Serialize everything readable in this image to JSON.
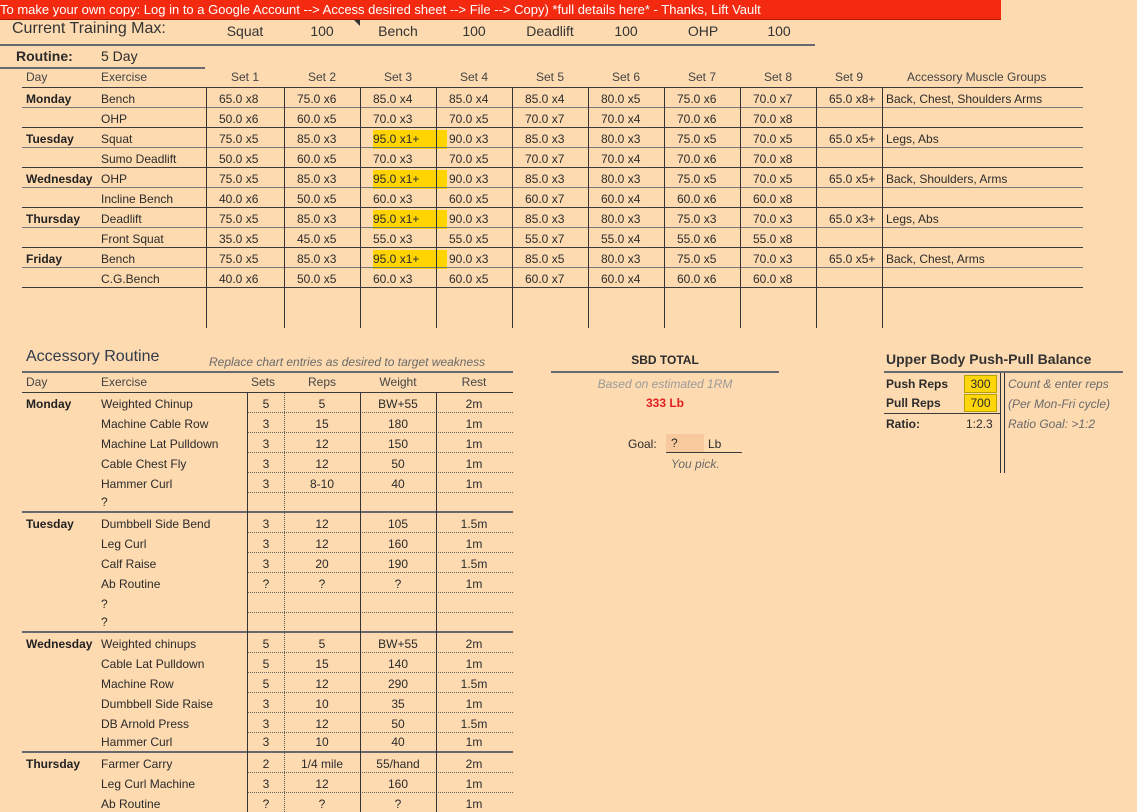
{
  "banner": "To make your own copy: Log in to a Google Account --> Access desired sheet --> File --> Copy) *full details here* - Thanks, Lift Vault",
  "tm": {
    "label": "Current Training Max:",
    "items": [
      {
        "name": "Squat",
        "value": "100"
      },
      {
        "name": "Bench",
        "value": "100"
      },
      {
        "name": "Deadlift",
        "value": "100"
      },
      {
        "name": "OHP",
        "value": "100"
      }
    ]
  },
  "routine": {
    "label": "Routine:",
    "value": "5 Day"
  },
  "main_headers": [
    "Day",
    "Exercise",
    "Set 1",
    "Set 2",
    "Set 3",
    "Set 4",
    "Set 5",
    "Set 6",
    "Set 7",
    "Set 8",
    "Set 9",
    "Accessory Muscle Groups"
  ],
  "main_rows": [
    {
      "day": "Monday",
      "ex": "Bench",
      "sets": [
        "65.0 x8",
        "75.0 x6",
        "85.0 x4",
        "85.0 x4",
        "85.0 x4",
        "80.0 x5",
        "75.0 x6",
        "70.0 x7",
        "65.0 x8+"
      ],
      "acc": "Back, Chest, Shoulders Arms"
    },
    {
      "day": "",
      "ex": "OHP",
      "sets": [
        "50.0 x6",
        "60.0 x5",
        "70.0 x3",
        "70.0 x5",
        "70.0 x7",
        "70.0 x4",
        "70.0 x6",
        "70.0 x8",
        ""
      ],
      "acc": ""
    },
    {
      "day": "Tuesday",
      "ex": "Squat",
      "sets": [
        "75.0 x5",
        "85.0 x3",
        "95.0 x1+",
        "90.0 x3",
        "85.0 x3",
        "80.0 x3",
        "75.0 x5",
        "70.0 x5",
        "65.0 x5+"
      ],
      "acc": "Legs, Abs"
    },
    {
      "day": "",
      "ex": "Sumo Deadlift",
      "sets": [
        "50.0 x5",
        "60.0 x5",
        "70.0 x3",
        "70.0 x5",
        "70.0 x7",
        "70.0 x4",
        "70.0 x6",
        "70.0 x8",
        ""
      ],
      "acc": ""
    },
    {
      "day": "Wednesday",
      "ex": "OHP",
      "sets": [
        "75.0 x5",
        "85.0 x3",
        "95.0 x1+",
        "90.0 x3",
        "85.0 x3",
        "80.0 x3",
        "75.0 x5",
        "70.0 x5",
        "65.0 x5+"
      ],
      "acc": "Back, Shoulders, Arms"
    },
    {
      "day": "",
      "ex": "Incline Bench",
      "sets": [
        "40.0 x6",
        "50.0 x5",
        "60.0 x3",
        "60.0 x5",
        "60.0 x7",
        "60.0 x4",
        "60.0 x6",
        "60.0 x8",
        ""
      ],
      "acc": ""
    },
    {
      "day": "Thursday",
      "ex": "Deadlift",
      "sets": [
        "75.0 x5",
        "85.0 x3",
        "95.0 x1+",
        "90.0 x3",
        "85.0 x3",
        "80.0 x3",
        "75.0 x3",
        "70.0 x3",
        "65.0 x3+"
      ],
      "acc": "Legs, Abs"
    },
    {
      "day": "",
      "ex": "Front Squat",
      "sets": [
        "35.0 x5",
        "45.0 x5",
        "55.0 x3",
        "55.0 x5",
        "55.0 x7",
        "55.0 x4",
        "55.0 x6",
        "55.0 x8",
        ""
      ],
      "acc": ""
    },
    {
      "day": "Friday",
      "ex": "Bench",
      "sets": [
        "75.0 x5",
        "85.0 x3",
        "95.0 x1+",
        "90.0 x3",
        "85.0 x5",
        "80.0 x3",
        "75.0 x5",
        "70.0 x3",
        "65.0 x5+"
      ],
      "acc": "Back, Chest, Arms"
    },
    {
      "day": "",
      "ex": "C.G.Bench",
      "sets": [
        "40.0 x6",
        "50.0 x5",
        "60.0 x3",
        "60.0 x5",
        "60.0 x7",
        "60.0 x4",
        "60.0 x6",
        "60.0 x8",
        ""
      ],
      "acc": ""
    }
  ],
  "accessory": {
    "title": "Accessory Routine",
    "hint": "Replace chart entries as desired to target weakness",
    "headers": [
      "Day",
      "Exercise",
      "Sets",
      "Reps",
      "Weight",
      "Rest"
    ],
    "rows": [
      {
        "day": "Monday",
        "ex": "Weighted Chinup",
        "sets": "5",
        "reps": "5",
        "weight": "BW+55",
        "rest": "2m"
      },
      {
        "day": "",
        "ex": "Machine Cable Row",
        "sets": "3",
        "reps": "15",
        "weight": "180",
        "rest": "1m"
      },
      {
        "day": "",
        "ex": "Machine Lat Pulldown",
        "sets": "3",
        "reps": "12",
        "weight": "150",
        "rest": "1m"
      },
      {
        "day": "",
        "ex": "Cable Chest Fly",
        "sets": "3",
        "reps": "12",
        "weight": "50",
        "rest": "1m"
      },
      {
        "day": "",
        "ex": "Hammer Curl",
        "sets": "3",
        "reps": "8-10",
        "weight": "40",
        "rest": "1m"
      },
      {
        "day": "",
        "ex": "?",
        "sets": "",
        "reps": "",
        "weight": "",
        "rest": ""
      },
      {
        "day": "Tuesday",
        "ex": "Dumbbell Side Bend",
        "sets": "3",
        "reps": "12",
        "weight": "105",
        "rest": "1.5m"
      },
      {
        "day": "",
        "ex": "Leg Curl",
        "sets": "3",
        "reps": "12",
        "weight": "160",
        "rest": "1m"
      },
      {
        "day": "",
        "ex": "Calf Raise",
        "sets": "3",
        "reps": "20",
        "weight": "190",
        "rest": "1.5m"
      },
      {
        "day": "",
        "ex": "Ab Routine",
        "sets": "?",
        "reps": "?",
        "weight": "?",
        "rest": "1m"
      },
      {
        "day": "",
        "ex": "?",
        "sets": "",
        "reps": "",
        "weight": "",
        "rest": ""
      },
      {
        "day": "",
        "ex": "?",
        "sets": "",
        "reps": "",
        "weight": "",
        "rest": ""
      },
      {
        "day": "Wednesday",
        "ex": "Weighted chinups",
        "sets": "5",
        "reps": "5",
        "weight": "BW+55",
        "rest": "2m"
      },
      {
        "day": "",
        "ex": "Cable Lat Pulldown",
        "sets": "5",
        "reps": "15",
        "weight": "140",
        "rest": "1m"
      },
      {
        "day": "",
        "ex": "Machine Row",
        "sets": "5",
        "reps": "12",
        "weight": "290",
        "rest": "1.5m"
      },
      {
        "day": "",
        "ex": "Dumbbell Side Raise",
        "sets": "3",
        "reps": "10",
        "weight": "35",
        "rest": "1m"
      },
      {
        "day": "",
        "ex": "DB Arnold Press",
        "sets": "3",
        "reps": "12",
        "weight": "50",
        "rest": "1.5m"
      },
      {
        "day": "",
        "ex": "Hammer Curl",
        "sets": "3",
        "reps": "10",
        "weight": "40",
        "rest": "1m"
      },
      {
        "day": "Thursday",
        "ex": "Farmer Carry",
        "sets": "2",
        "reps": "1/4 mile",
        "weight": "55/hand",
        "rest": "2m"
      },
      {
        "day": "",
        "ex": "Leg Curl Machine",
        "sets": "3",
        "reps": "12",
        "weight": "160",
        "rest": "1m"
      },
      {
        "day": "",
        "ex": "Ab Routine",
        "sets": "?",
        "reps": "?",
        "weight": "?",
        "rest": "1m"
      }
    ]
  },
  "sbd": {
    "title": "SBD TOTAL",
    "note": "Based on estimated 1RM",
    "total": "333 Lb",
    "goal_label": "Goal:",
    "goal_value": "?",
    "goal_unit": "Lb",
    "goal_note": "You pick."
  },
  "balance": {
    "title": "Upper Body Push-Pull Balance",
    "push_label": "Push Reps",
    "push_value": "300",
    "pull_label": "Pull Reps",
    "pull_value": "700",
    "ratio_label": "Ratio:",
    "ratio_value": "1:2.3",
    "note1": "Count & enter reps",
    "note2": "(Per Mon-Fri cycle)",
    "note3": "Ratio Goal: >1:2"
  },
  "colors": {
    "highlight": "#ffd400",
    "total_red": "#e02020",
    "banner": "#f42a10",
    "sheet_bg": "#fddab0"
  }
}
